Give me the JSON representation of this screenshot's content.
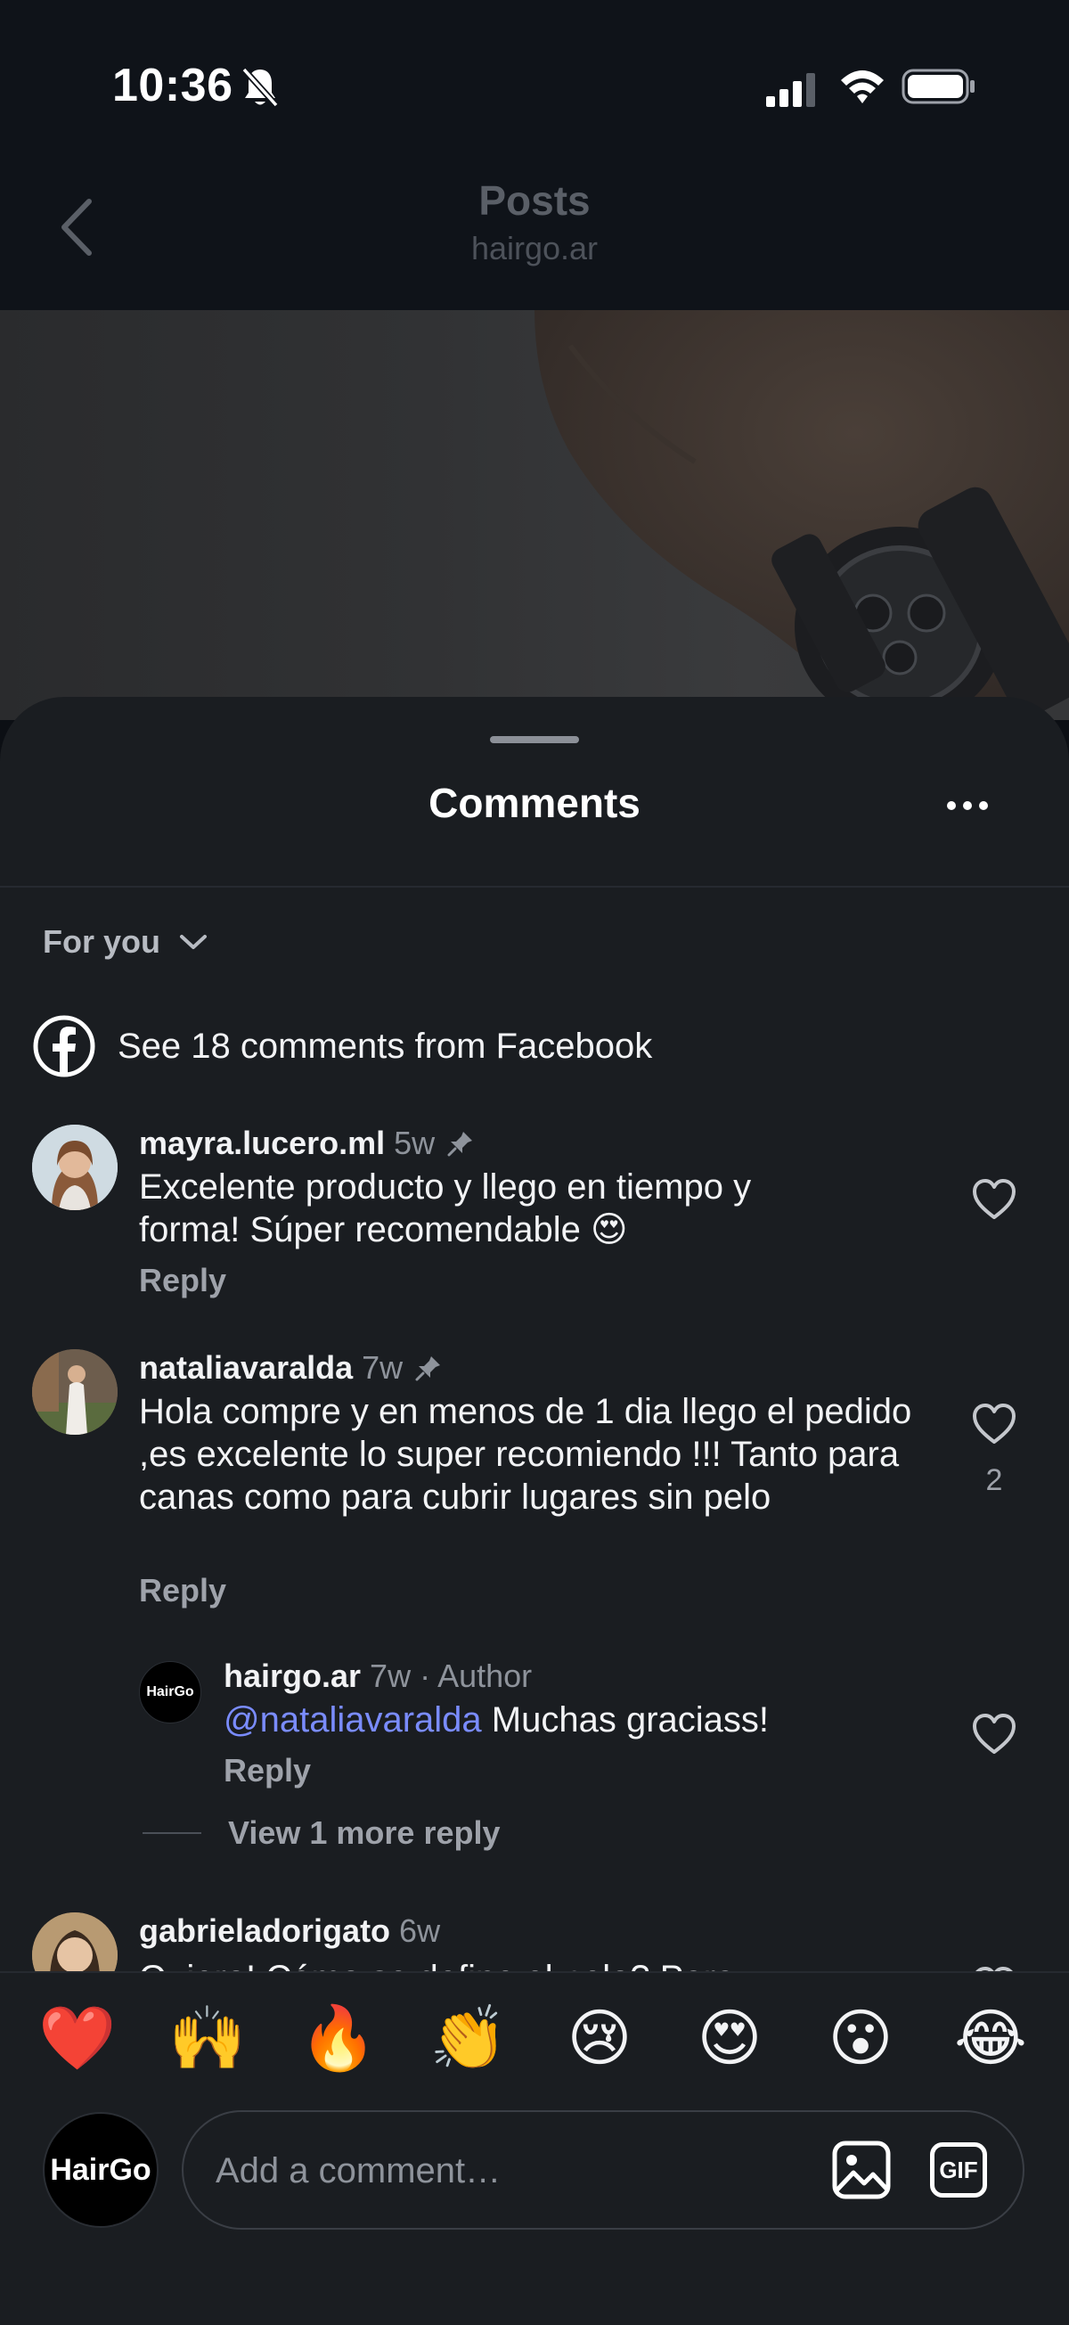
{
  "status_bar": {
    "time": "10:36"
  },
  "header": {
    "title": "Posts",
    "subtitle": "hairgo.ar"
  },
  "sheet": {
    "title": "Comments"
  },
  "filter": {
    "label": "For you"
  },
  "facebook": {
    "text": "See 18 comments from Facebook"
  },
  "comments": [
    {
      "user": "mayra.lucero.ml",
      "time": "5w",
      "pinned": true,
      "text": "Excelente producto y llego en tiempo y forma! Súper recomendable 😍",
      "reply_label": "Reply"
    },
    {
      "user": "nataliavaralda",
      "time": "7w",
      "pinned": true,
      "text": "Hola compre y en menos de 1 dia llego el pedido ,es excelente lo super recomiendo !!! Tanto para canas como para cubrir lugares sin pelo",
      "likes": "2",
      "reply_label": "Reply",
      "replies": [
        {
          "user": "hairgo.ar",
          "time": "7w",
          "badge": "· Author",
          "mention": "@nataliavaralda",
          "text": "Muchas graciass!",
          "reply_label": "Reply",
          "avatar_text": "HairGo"
        }
      ],
      "view_more": "View 1 more reply"
    },
    {
      "user": "gabrieladorigato",
      "time": "6w",
      "text": "Quiero! Cómo se define el pelo? Para"
    }
  ],
  "emoji_bar": [
    "❤️",
    "🙌",
    "🔥",
    "👏",
    "😢",
    "😍",
    "😮",
    "😂"
  ],
  "composer": {
    "avatar_text": "HairGo",
    "placeholder": "Add a comment…",
    "gif_label": "GIF"
  },
  "colors": {
    "background": "#1a1d21",
    "mention": "#7a8cff",
    "secondary_text": "#8e939b"
  }
}
